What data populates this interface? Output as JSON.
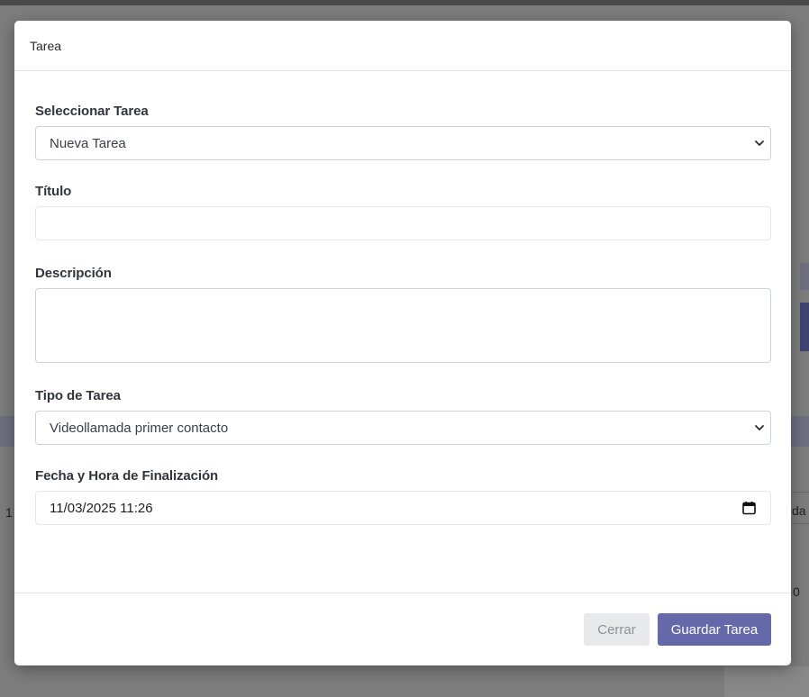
{
  "modal": {
    "title": "Tarea",
    "fields": {
      "task_select": {
        "label": "Seleccionar Tarea",
        "value": "Nueva Tarea"
      },
      "title": {
        "label": "Título",
        "value": ""
      },
      "description": {
        "label": "Descripción",
        "value": ""
      },
      "task_type": {
        "label": "Tipo de Tarea",
        "value": "Videollamada primer contacto"
      },
      "due_datetime": {
        "label": "Fecha y Hora de Finalización",
        "value": "11/03/2025 11:26"
      }
    },
    "footer": {
      "close_label": "Cerrar",
      "save_label": "Guardar Tarea"
    }
  },
  "background": {
    "left_fragment": "1",
    "right_fragment_1": "da",
    "right_fragment_2": "0"
  },
  "colors": {
    "primary": "#6669a9",
    "secondary": "#e8e9eb",
    "overlay": "#7d7d7d"
  }
}
